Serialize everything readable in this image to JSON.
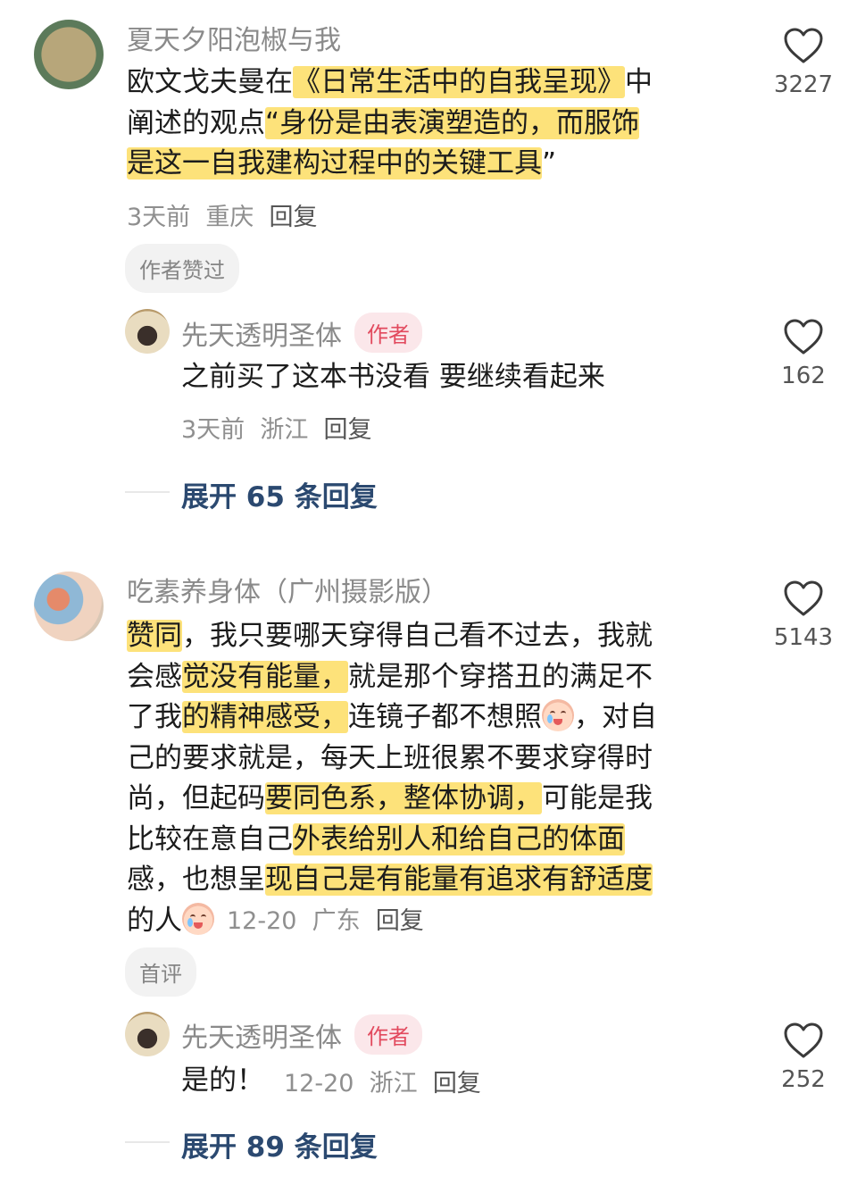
{
  "comments": [
    {
      "username": "夏天夕阳泡椒与我",
      "text_lines": [
        [
          {
            "t": "欧文戈夫曼在",
            "h": false
          },
          {
            "t": "《日常生活中的自我呈现》",
            "h": true
          },
          {
            "t": "中",
            "h": false
          }
        ],
        [
          {
            "t": "阐述的观点",
            "h": false
          },
          {
            "t": "“身份是由表演塑造的，而服饰",
            "h": true
          }
        ],
        [
          {
            "t": "是这一自我建构过程中的关键工具",
            "h": true
          },
          {
            "t": "”",
            "h": false
          }
        ]
      ],
      "time": "3天前",
      "location": "重庆",
      "reply_label": "回复",
      "tag": "作者赞过",
      "likes": "3227",
      "reply": {
        "username": "先天透明圣体",
        "badge": "作者",
        "text": "之前买了这本书没看 要继续看起来",
        "time": "3天前",
        "location": "浙江",
        "reply_label": "回复",
        "likes": "162"
      },
      "expand_label": "展开 65 条回复"
    },
    {
      "username": "吃素养身体（广州摄影版）",
      "text_lines": [
        [
          {
            "t": "赞同",
            "h": true
          },
          {
            "t": "，我只要哪天穿得自己看不过去，我就",
            "h": false
          }
        ],
        [
          {
            "t": "会感",
            "h": false
          },
          {
            "t": "觉没有能量，",
            "h": true
          },
          {
            "t": "就是那个穿搭丑的满足不",
            "h": false
          }
        ],
        [
          {
            "t": "了我",
            "h": false
          },
          {
            "t": "的精神感受，",
            "h": true
          },
          {
            "t": "连镜子都不想照",
            "h": false
          },
          {
            "t": "[emoji]",
            "h": false
          },
          {
            "t": "，对自",
            "h": false
          }
        ],
        [
          {
            "t": "己的要求就是，每天上班很累不要求穿得时",
            "h": false
          }
        ],
        [
          {
            "t": "尚，但起码",
            "h": false
          },
          {
            "t": "要同色系，整体协调，",
            "h": true
          },
          {
            "t": "可能是我",
            "h": false
          }
        ],
        [
          {
            "t": "比较在意自己",
            "h": false
          },
          {
            "t": "外表给别人和给自己的体面",
            "h": true
          }
        ],
        [
          {
            "t": "感，也想呈",
            "h": false
          },
          {
            "t": "现自己是有能量有追求有舒适度",
            "h": true
          }
        ],
        [
          {
            "t": "的人",
            "h": false
          },
          {
            "t": "[emoji]",
            "h": false
          }
        ]
      ],
      "time": "12-20",
      "location": "广东",
      "reply_label": "回复",
      "tag": "首评",
      "likes": "5143",
      "reply": {
        "username": "先天透明圣体",
        "badge": "作者",
        "text": "是的！",
        "time": "12-20",
        "location": "浙江",
        "reply_label": "回复",
        "likes": "252"
      },
      "expand_label": "展开 89 条回复"
    }
  ],
  "icons": {
    "like": "heart-outline-icon",
    "emoji": "crying-face-emoji-icon"
  },
  "colors": {
    "highlight": "#fde27a",
    "author_badge_bg": "#fbe7ea",
    "author_badge_text": "#e24a5e",
    "expand_text": "#2b4970"
  }
}
